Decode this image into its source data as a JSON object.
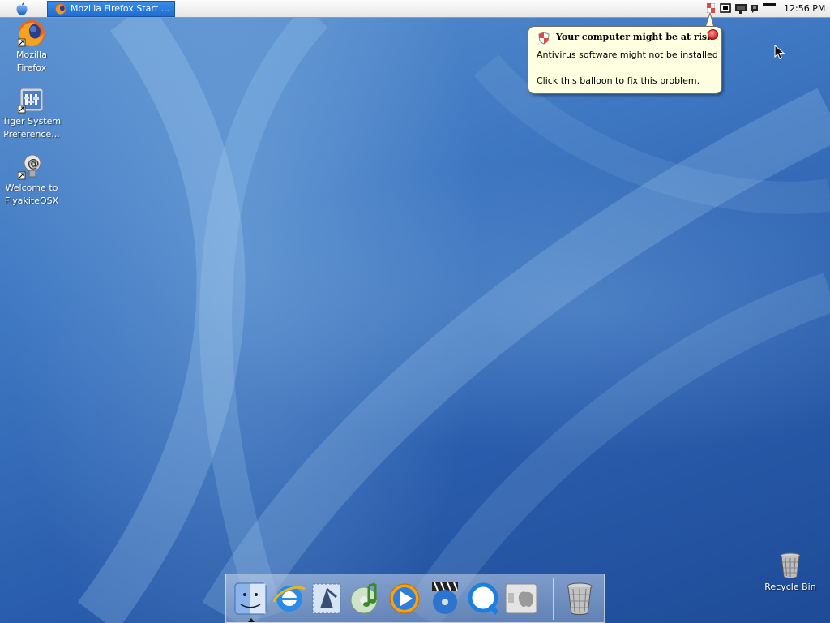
{
  "taskbar": {
    "active_task": "Mozilla Firefox Start ...",
    "clock": "12:56 PM"
  },
  "tray_icons": [
    "security-alert-icon",
    "network-icon",
    "display-icon",
    "speech-icon",
    "volume-icon",
    "battery-icon"
  ],
  "balloon": {
    "title": "Your computer might be at risk",
    "line1": "Antivirus software might not be installed",
    "line2": "Click this balloon to fix this problem."
  },
  "desktop_icons": [
    {
      "label_line1": "Mozilla",
      "label_line2": "Firefox",
      "icon": "firefox-icon"
    },
    {
      "label_line1": "Tiger System",
      "label_line2": "Preference...",
      "icon": "system-preferences-icon"
    },
    {
      "label_line1": "Welcome to",
      "label_line2": "FlyakiteOSX",
      "icon": "welcome-icon"
    },
    {
      "label_line1": "Recycle Bin",
      "label_line2": "",
      "icon": "recycle-bin-icon"
    }
  ],
  "dock_items": [
    "finder-icon",
    "internet-explorer-icon",
    "mail-icon",
    "itunes-icon",
    "media-player-icon",
    "dvd-player-icon",
    "quicktime-icon",
    "system-preferences-dock-icon",
    "trash-icon"
  ],
  "colors": {
    "menubar": "#f2f2f2",
    "task_button": "#2a7be0",
    "balloon_background": "#ffffe1",
    "desktop": "#2f67b3"
  }
}
